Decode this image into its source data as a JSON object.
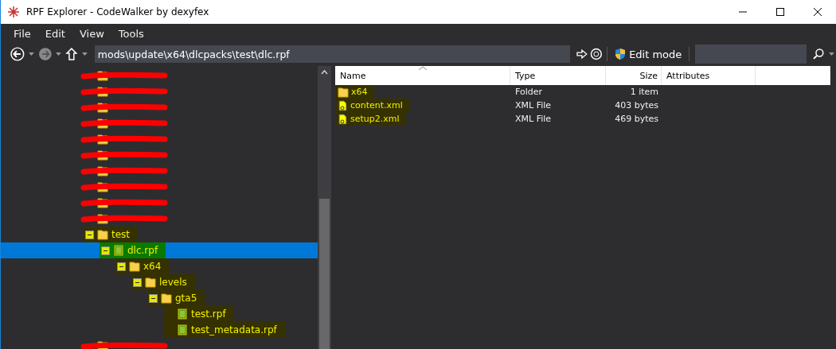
{
  "window": {
    "title": "RPF Explorer - CodeWalker by dexyfex"
  },
  "menu": [
    "File",
    "Edit",
    "View",
    "Tools"
  ],
  "toolbar": {
    "address": "mods\\update\\x64\\dlcpacks\\test\\dlc.rpf",
    "edit_mode": "Edit mode"
  },
  "tree": [
    {
      "kind": "redacted",
      "selected": false
    },
    {
      "kind": "redacted",
      "selected": false
    },
    {
      "kind": "redacted",
      "selected": false
    },
    {
      "kind": "redacted",
      "selected": false
    },
    {
      "kind": "redacted",
      "selected": false
    },
    {
      "kind": "redacted",
      "selected": false
    },
    {
      "kind": "redacted",
      "selected": false
    },
    {
      "kind": "redacted",
      "selected": false
    },
    {
      "kind": "redacted",
      "selected": false
    },
    {
      "kind": "redacted",
      "selected": false
    },
    {
      "kind": "folder",
      "label": "test",
      "expanded": true,
      "highlighted": true,
      "selected": false,
      "children": [
        {
          "kind": "archive",
          "label": "dlc.rpf",
          "expanded": true,
          "highlighted": true,
          "selected": true,
          "children": [
            {
              "kind": "folder",
              "label": "x64",
              "expanded": true,
              "highlighted": true,
              "selected": false,
              "children": [
                {
                  "kind": "folder",
                  "label": "levels",
                  "expanded": true,
                  "highlighted": true,
                  "selected": false,
                  "children": [
                    {
                      "kind": "folder",
                      "label": "gta5",
                      "expanded": true,
                      "highlighted": true,
                      "selected": false,
                      "children": [
                        {
                          "kind": "archive",
                          "label": "test.rpf",
                          "highlighted": true,
                          "selected": false
                        },
                        {
                          "kind": "archive",
                          "label": "test_metadata.rpf",
                          "highlighted": true,
                          "selected": false
                        }
                      ]
                    }
                  ]
                }
              ]
            }
          ]
        }
      ]
    },
    {
      "kind": "redacted",
      "selected": false
    }
  ],
  "file_list": {
    "columns": [
      "Name",
      "Type",
      "Size",
      "Attributes"
    ],
    "rows": [
      {
        "kind": "folder",
        "name": "x64",
        "type": "Folder",
        "size": "1 item",
        "highlighted": true
      },
      {
        "kind": "xml",
        "name": "content.xml",
        "type": "XML File",
        "size": "403 bytes",
        "highlighted": true
      },
      {
        "kind": "xml",
        "name": "setup2.xml",
        "type": "XML File",
        "size": "469 bytes",
        "highlighted": true
      }
    ]
  }
}
